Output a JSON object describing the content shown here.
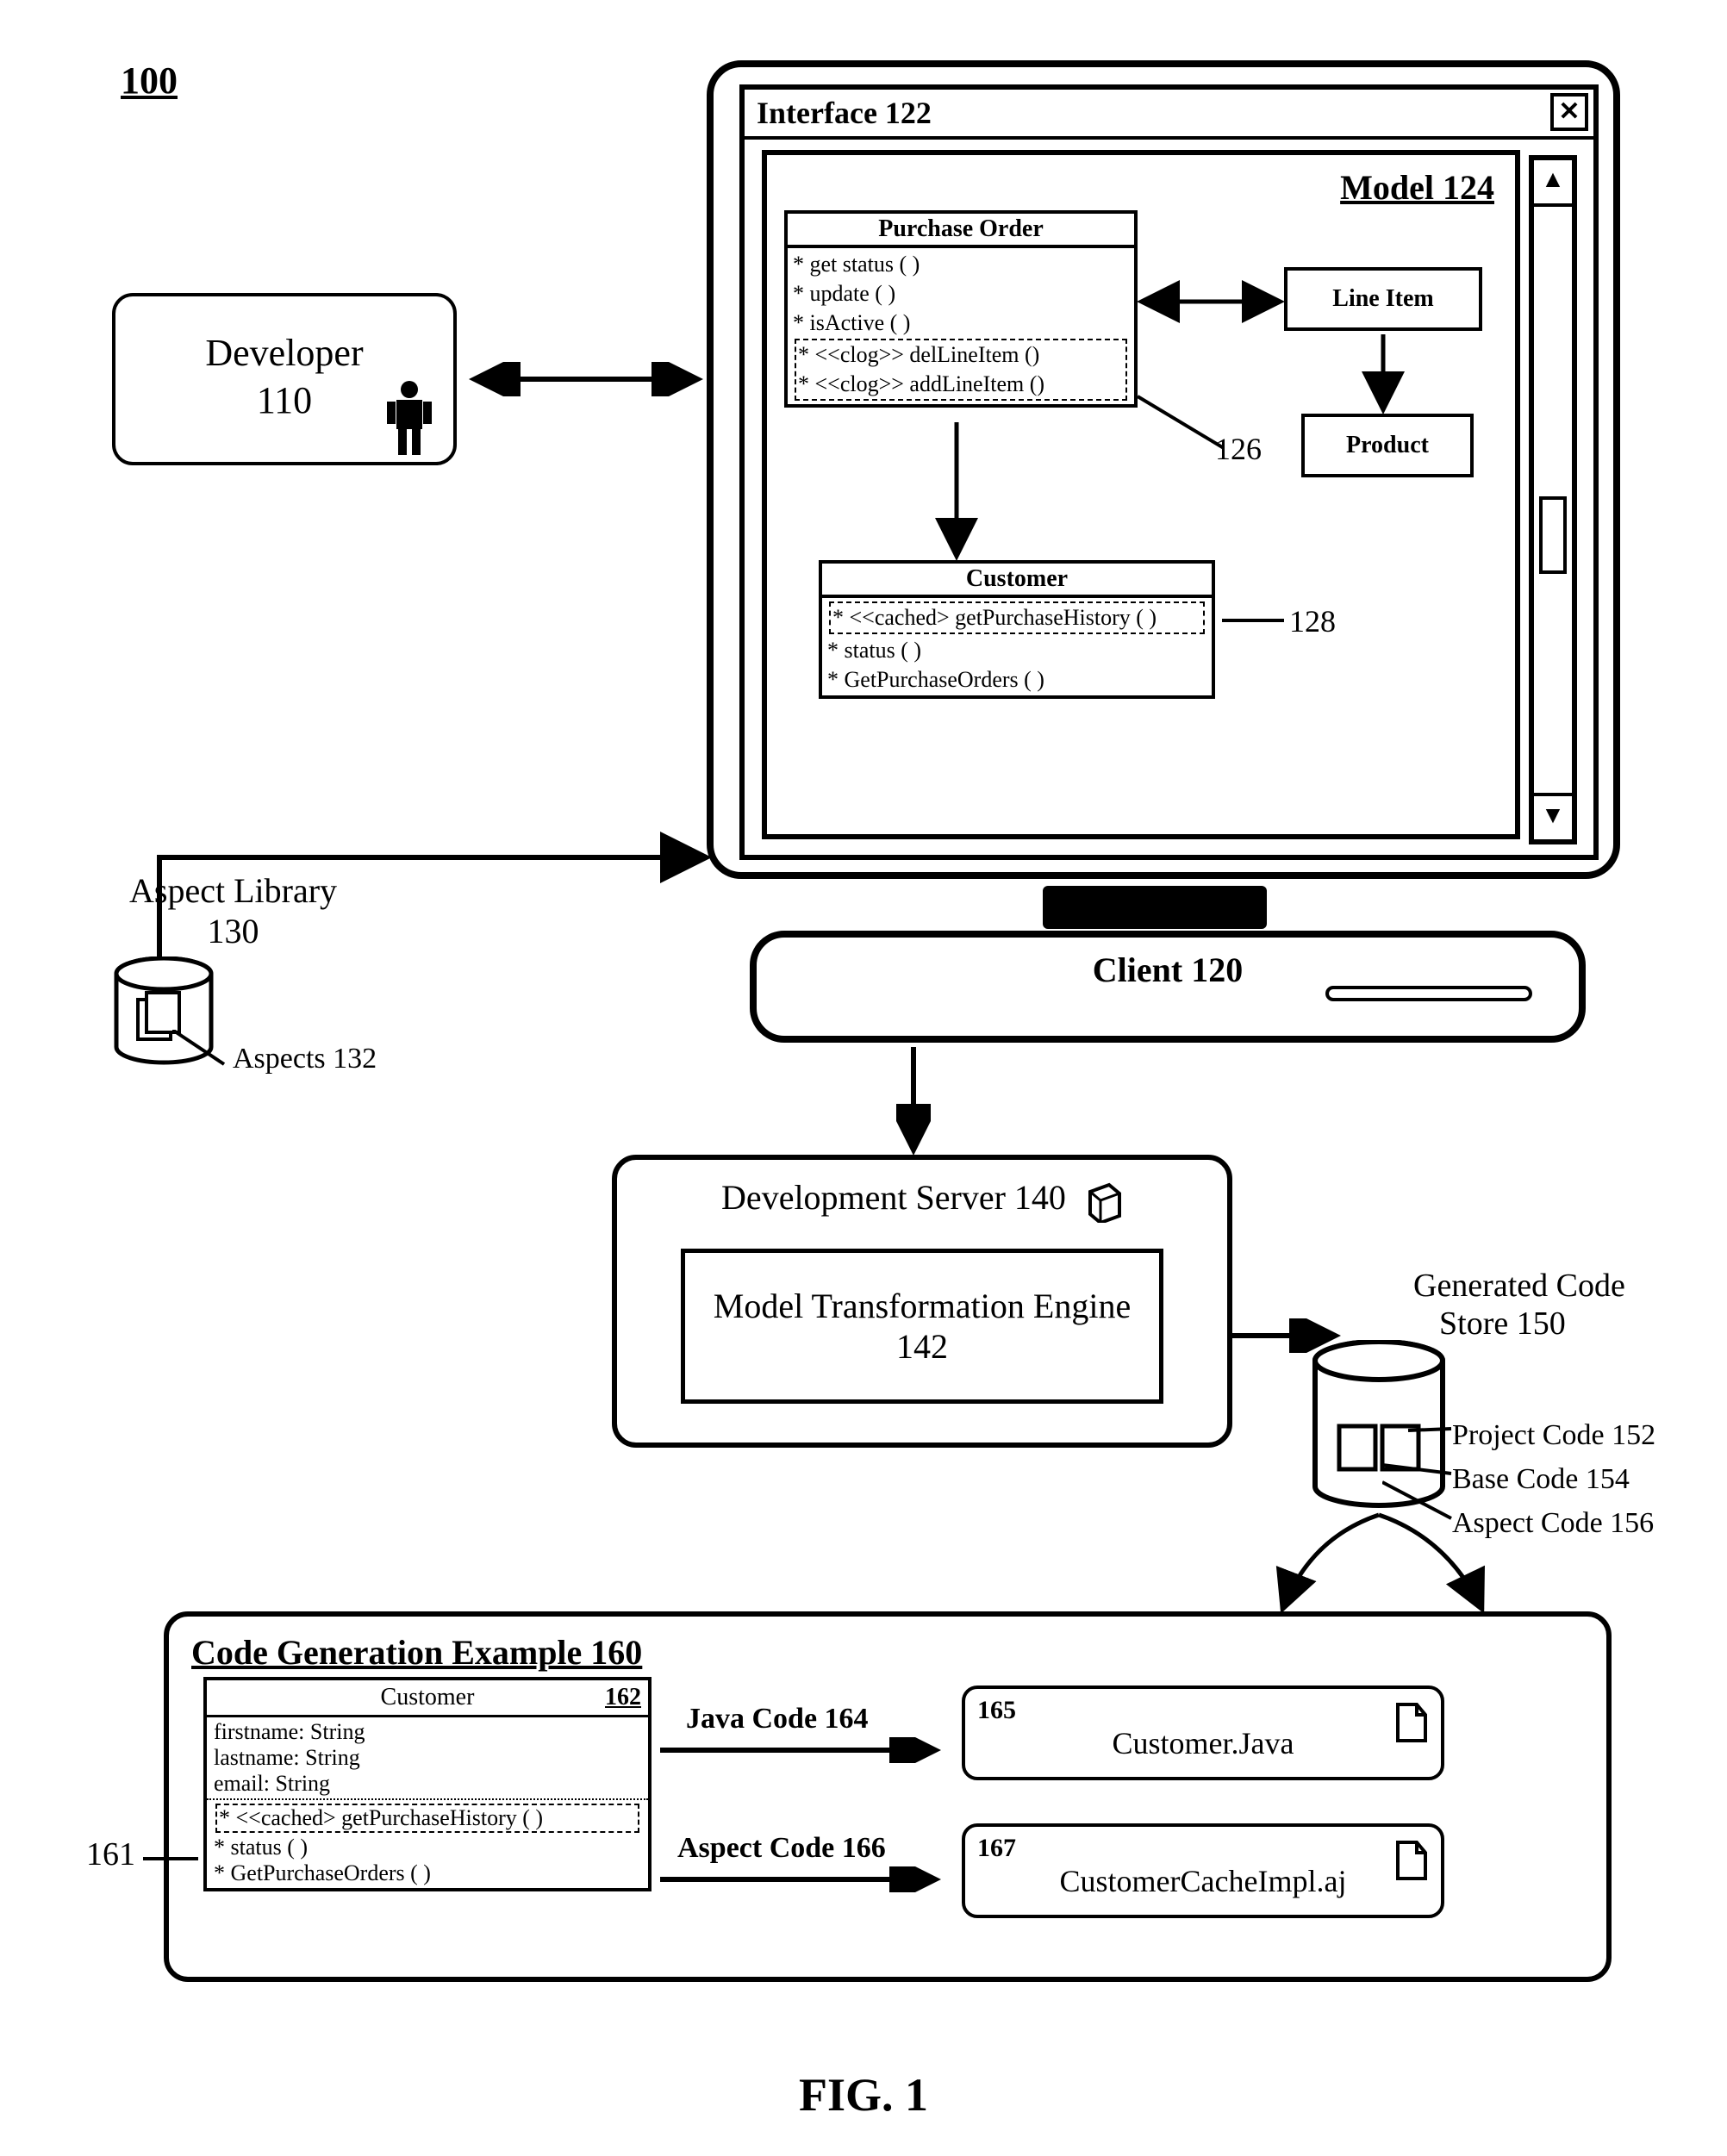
{
  "figure_label": "FIG. 1",
  "system_ref": "100",
  "developer": {
    "label": "Developer",
    "ref": "110"
  },
  "interface": {
    "label": "Interface 122",
    "model_label": "Model 124",
    "ref_clog": "126",
    "ref_cached": "128",
    "purchase_order": {
      "title": "Purchase Order",
      "m1": "* get status ( )",
      "m2": "* update ( )",
      "m3": "* isActive ( )",
      "m4": "* <<clog>> delLineItem ()",
      "m5": "* <<clog>> addLineItem ()"
    },
    "customer": {
      "title": "Customer",
      "m1": "* <<cached> getPurchaseHistory ( )",
      "m2": "* status ( )",
      "m3": "* GetPurchaseOrders ( )"
    },
    "line_item": "Line Item",
    "product": "Product"
  },
  "client": {
    "label": "Client 120"
  },
  "aspect_lib": {
    "label": "Aspect Library",
    "ref": "130",
    "aspects": "Aspects 132"
  },
  "dev_server": {
    "label": "Development Server 140",
    "mte": "Model Transformation Engine 142"
  },
  "code_store": {
    "label": "Generated Code",
    "label2": "Store 150",
    "i1": "Project Code 152",
    "i2": "Base Code 154",
    "i3": "Aspect Code 156"
  },
  "cge": {
    "title": "Code Generation Example 160",
    "ref161": "161",
    "cust_box": {
      "title": "Customer",
      "badge": "162",
      "a1": "firstname: String",
      "a2": "lastname: String",
      "a3": "email: String",
      "m1": "* <<cached> getPurchaseHistory ( )",
      "m2": "* status ( )",
      "m3": "* GetPurchaseOrders ( )"
    },
    "java_label": "Java Code 164",
    "aspect_label": "Aspect Code 166",
    "file1": {
      "id": "165",
      "name": "Customer.Java"
    },
    "file2": {
      "id": "167",
      "name": "CustomerCacheImpl.aj"
    }
  }
}
